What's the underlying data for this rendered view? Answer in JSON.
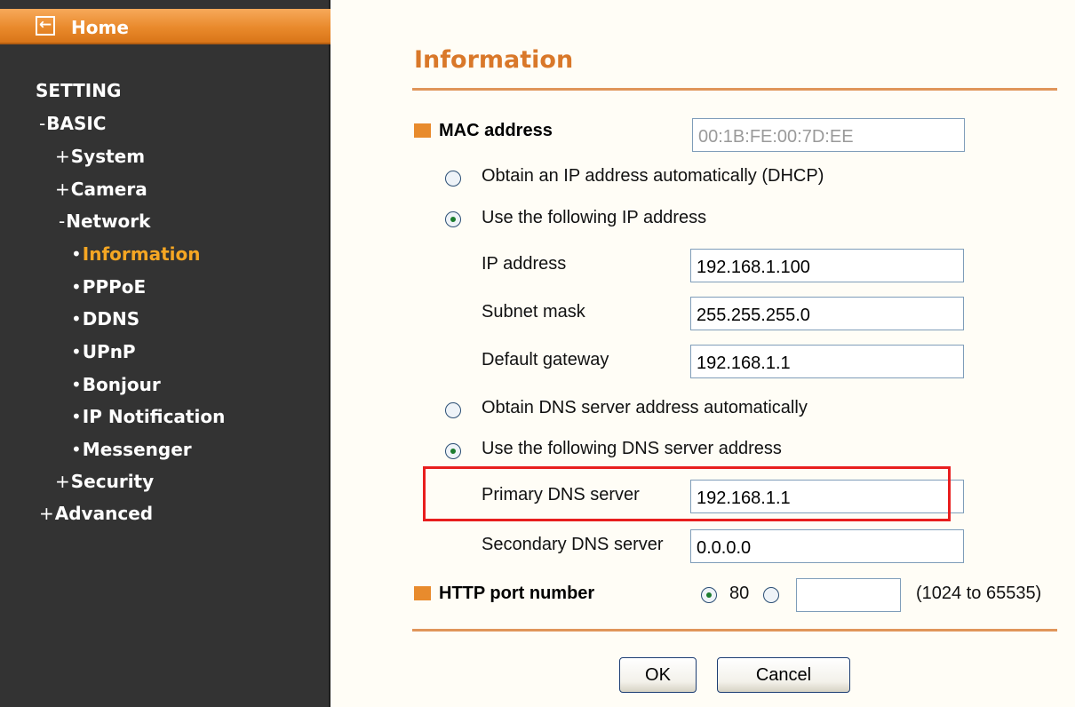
{
  "sidebar": {
    "home_icon": "back-arrow-icon",
    "home_glyph": "←",
    "home_label": "Home",
    "setting": "SETTING",
    "basic": "BASIC",
    "system": "System",
    "camera": "Camera",
    "network": "Network",
    "information": "Information",
    "pppoe": "PPPoE",
    "ddns": "DDNS",
    "upnp": "UPnP",
    "bonjour": "Bonjour",
    "ip_notification": "IP Notification",
    "messenger": "Messenger",
    "security": "Security",
    "advanced": "Advanced",
    "expand_mark": "+",
    "collapse_mark": "-",
    "bullet": "•"
  },
  "main": {
    "title": "Information",
    "mac": {
      "label": "MAC address",
      "value": "00:1B:FE:00:7D:EE"
    },
    "ip_auto_label": "Obtain an IP address automatically (DHCP)",
    "ip_manual_label": "Use the following IP address",
    "ip_address": {
      "label": "IP address",
      "value": "192.168.1.100"
    },
    "subnet_mask": {
      "label": "Subnet mask",
      "value": "255.255.255.0"
    },
    "gateway": {
      "label": "Default gateway",
      "value": "192.168.1.1"
    },
    "dns_auto_label": "Obtain DNS server address automatically",
    "dns_manual_label": "Use the following DNS server address",
    "primary_dns": {
      "label": "Primary DNS server",
      "value": "192.168.1.1"
    },
    "secondary_dns": {
      "label": "Secondary DNS server",
      "value": "0.0.0.0"
    },
    "http": {
      "label": "HTTP port number",
      "default_port": "80",
      "custom_value": "",
      "range": "(1024 to 65535)"
    },
    "ok_label": "OK",
    "cancel_label": "Cancel"
  },
  "colors": {
    "accent": "#e88b2d",
    "title": "#d9782a",
    "sidebar_bg": "#333333",
    "active_nav": "#f5a623",
    "highlight": "#e81e1e"
  }
}
